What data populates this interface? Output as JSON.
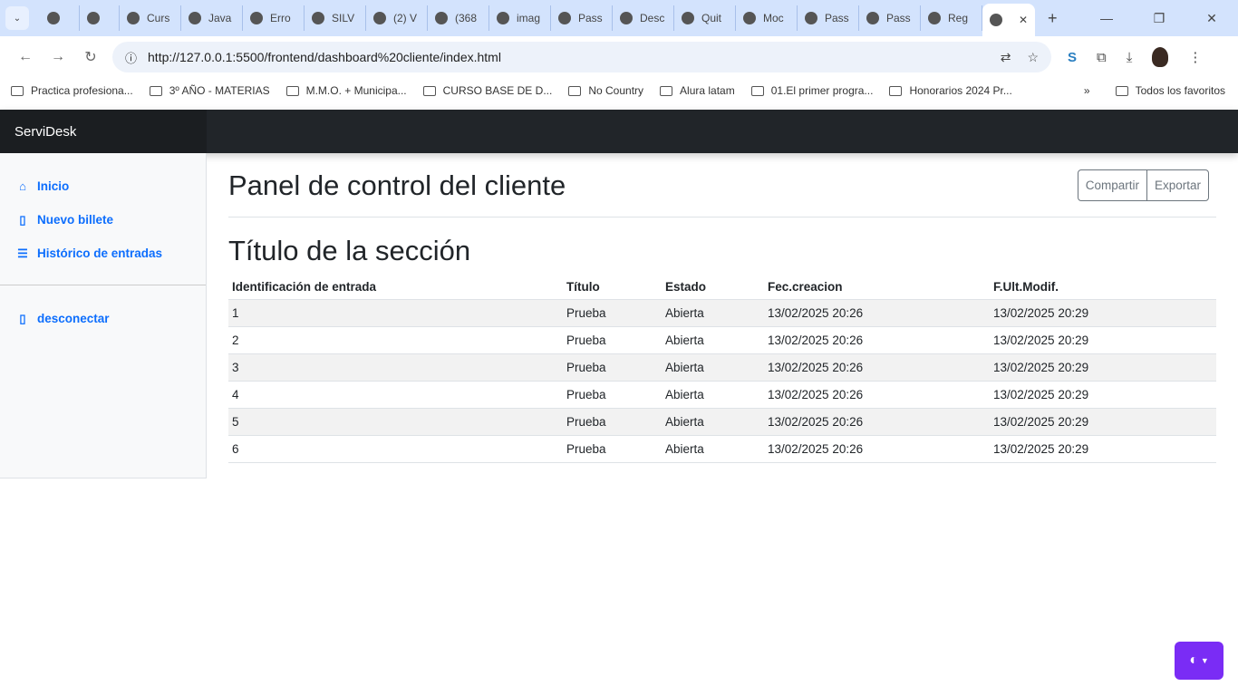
{
  "browser": {
    "tabs": [
      "",
      "",
      "Curs",
      "Java",
      "Erro",
      "SILV",
      "(2) V",
      "(368",
      "imag",
      "Pass",
      "Desc",
      "Quit",
      "Moc",
      "Pass",
      "Pass",
      "Reg"
    ],
    "url": "http://127.0.0.1:5500/frontend/dashboard%20cliente/index.html",
    "bookmarks": [
      "Practica profesiona...",
      "3º AÑO - MATERIAS",
      "M.M.O. + Municipa...",
      "CURSO BASE DE D...",
      "No Country",
      "Alura latam",
      "01.El primer progra...",
      "Honorarios 2024 Pr..."
    ],
    "all_bookmarks": "Todos los favoritos"
  },
  "brand": "ServiDesk",
  "sidebar": {
    "items": [
      {
        "label": "Inicio",
        "icon": "house-icon"
      },
      {
        "label": "Nuevo billete",
        "icon": "file-icon"
      },
      {
        "label": "Histórico de entradas",
        "icon": "file-text-icon"
      }
    ],
    "logout": "desconectar"
  },
  "main": {
    "title": "Panel de control del cliente",
    "share": "Compartir",
    "export": "Exportar",
    "section_title": "Título de la sección",
    "columns": [
      "Identificación de entrada",
      "Título",
      "Estado",
      "Fec.creacion",
      "F.Ult.Modif."
    ],
    "rows": [
      [
        "1",
        "Prueba",
        "Abierta",
        "13/02/2025 20:26",
        "13/02/2025 20:29"
      ],
      [
        "2",
        "Prueba",
        "Abierta",
        "13/02/2025 20:26",
        "13/02/2025 20:29"
      ],
      [
        "3",
        "Prueba",
        "Abierta",
        "13/02/2025 20:26",
        "13/02/2025 20:29"
      ],
      [
        "4",
        "Prueba",
        "Abierta",
        "13/02/2025 20:26",
        "13/02/2025 20:29"
      ],
      [
        "5",
        "Prueba",
        "Abierta",
        "13/02/2025 20:26",
        "13/02/2025 20:29"
      ],
      [
        "6",
        "Prueba",
        "Abierta",
        "13/02/2025 20:26",
        "13/02/2025 20:29"
      ]
    ]
  },
  "colors": {
    "accent": "#0d6efd",
    "navbar": "#212529",
    "theme_button": "#7a2cf5"
  }
}
